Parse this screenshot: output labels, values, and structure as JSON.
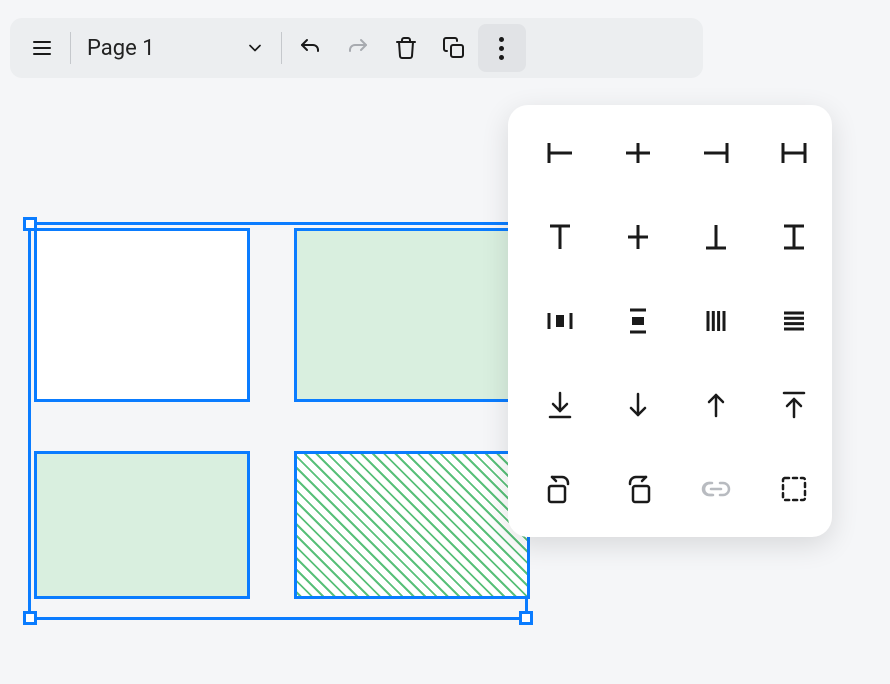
{
  "toolbar": {
    "page_label": "Page 1",
    "menu_icon": "menu",
    "dropdown_icon": "chevron-down",
    "undo_icon": "undo",
    "redo_icon": "redo",
    "delete_icon": "trash",
    "copy_icon": "copy",
    "more_icon": "more-vertical",
    "redo_disabled": true
  },
  "canvas": {
    "selection": {
      "cells": [
        {
          "fill": "white",
          "pattern": "none"
        },
        {
          "fill": "#d9efdf",
          "pattern": "none"
        },
        {
          "fill": "#d9efdf",
          "pattern": "none"
        },
        {
          "fill": "white",
          "pattern": "diagonal-hatch-green"
        }
      ],
      "selection_color": "#0a7cff"
    }
  },
  "alignment_panel": {
    "rows": [
      [
        "align-left",
        "align-center-horizontal",
        "align-right",
        "align-stretch-horizontal"
      ],
      [
        "align-top",
        "align-center-vertical",
        "align-bottom",
        "align-stretch-vertical"
      ],
      [
        "distribute-horizontal",
        "distribute-vertical",
        "distribute-columns",
        "distribute-rows"
      ],
      [
        "arrow-down-line",
        "arrow-down",
        "arrow-up",
        "arrow-up-line"
      ],
      [
        "rotate-left",
        "rotate-right",
        "link",
        "selection-bounds"
      ]
    ],
    "link_disabled": true
  }
}
